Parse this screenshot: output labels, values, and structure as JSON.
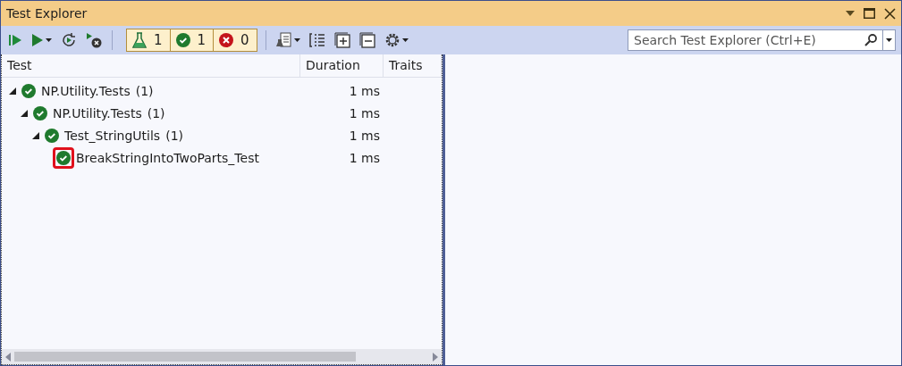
{
  "window": {
    "title": "Test Explorer"
  },
  "summary": [
    {
      "kind": "total",
      "count": "1"
    },
    {
      "kind": "passed",
      "count": "1"
    },
    {
      "kind": "failed",
      "count": "0"
    }
  ],
  "search": {
    "placeholder": "Search Test Explorer (Ctrl+E)"
  },
  "columns": [
    "Test",
    "Duration",
    "Traits"
  ],
  "tree": [
    {
      "name": "NP.Utility.Tests",
      "count": "(1)",
      "duration": "1 ms",
      "expanded": true,
      "highlighted": false,
      "children": [
        {
          "name": "NP.Utility.Tests",
          "count": "(1)",
          "duration": "1 ms",
          "expanded": true,
          "highlighted": false,
          "children": [
            {
              "name": "Test_StringUtils",
              "count": "(1)",
              "duration": "1 ms",
              "expanded": true,
              "highlighted": false,
              "children": [
                {
                  "name": "BreakStringIntoTwoParts_Test",
                  "duration": "1 ms",
                  "highlighted": true
                }
              ]
            }
          ]
        }
      ]
    }
  ]
}
